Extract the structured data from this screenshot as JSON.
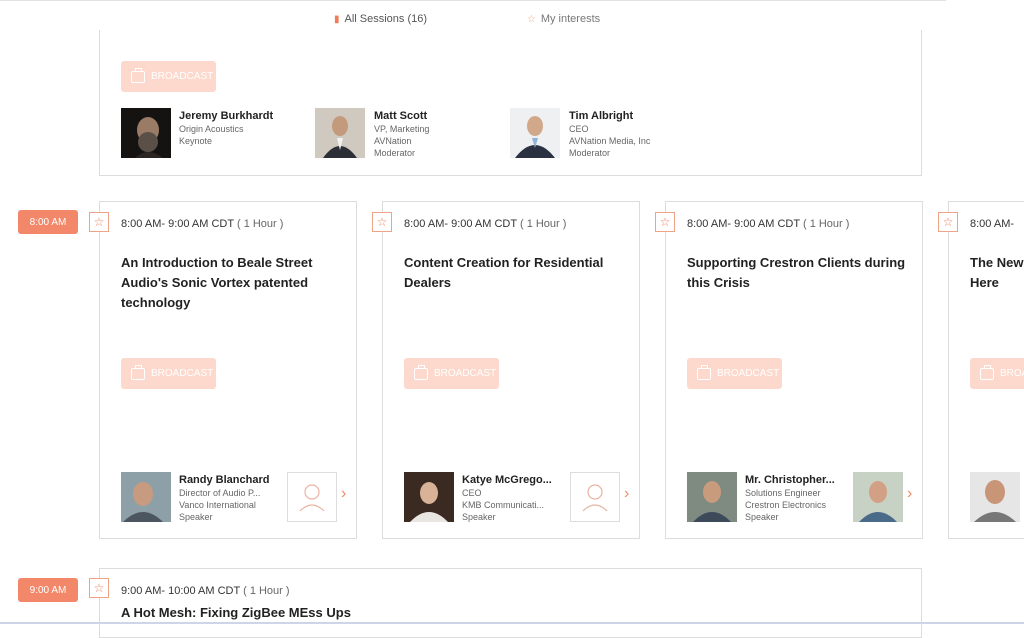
{
  "tabs": {
    "all_sessions": "All Sessions (16)",
    "my_interests": "My interests"
  },
  "common": {
    "broadcast_label": "BROADCAST",
    "star_glyph": "☆",
    "chevron_glyph": "›"
  },
  "top_session": {
    "speakers": [
      {
        "name": "Jeremy Burkhardt",
        "line1": "Origin Acoustics",
        "line2": "Keynote",
        "line3": ""
      },
      {
        "name": "Matt Scott",
        "line1": "VP, Marketing",
        "line2": "AVNation",
        "line3": "Moderator"
      },
      {
        "name": "Tim Albright",
        "line1": "CEO",
        "line2": "AVNation Media, Inc",
        "line3": "Moderator"
      }
    ]
  },
  "slots": [
    {
      "badge": "8:00 AM"
    },
    {
      "badge": "9:00 AM"
    }
  ],
  "sessions_8am": [
    {
      "time": "8:00 AM- 9:00 AM CDT",
      "duration": "( 1 Hour )",
      "title_lines": [
        "An Introduction to Beale Street",
        "Audio's Sonic Vortex patented",
        "technology"
      ],
      "speaker": {
        "name": "Randy Blanchard",
        "line1": "Director of Audio P...",
        "line2": "Vanco International",
        "line3": "Speaker"
      }
    },
    {
      "time": "8:00 AM- 9:00 AM CDT",
      "duration": "( 1 Hour )",
      "title_lines": [
        "Content Creation for Residential",
        "Dealers",
        ""
      ],
      "speaker": {
        "name": "Katye McGrego...",
        "line1": "CEO",
        "line2": "KMB Communicati...",
        "line3": "Speaker"
      }
    },
    {
      "time": "8:00 AM- 9:00 AM CDT",
      "duration": "( 1 Hour )",
      "title_lines": [
        "Supporting Crestron Clients during",
        "this Crisis",
        ""
      ],
      "speaker": {
        "name": "Mr. Christopher...",
        "line1": "Solutions Engineer",
        "line2": "Crestron Electronics",
        "line3": "Speaker"
      }
    },
    {
      "time": "8:00 AM-",
      "duration": "",
      "title_lines": [
        "The New",
        "Here",
        ""
      ],
      "speaker": {
        "name": "",
        "line1": "",
        "line2": "",
        "line3": ""
      }
    }
  ],
  "session_9am": {
    "time": "9:00 AM- 10:00 AM CDT",
    "duration": "( 1 Hour )",
    "title": "A Hot Mesh: Fixing ZigBee MEss Ups"
  },
  "colors": {
    "accent": "#f2876a",
    "broadcast_bg": "#fcd9cc",
    "border": "#dcdcdc"
  }
}
